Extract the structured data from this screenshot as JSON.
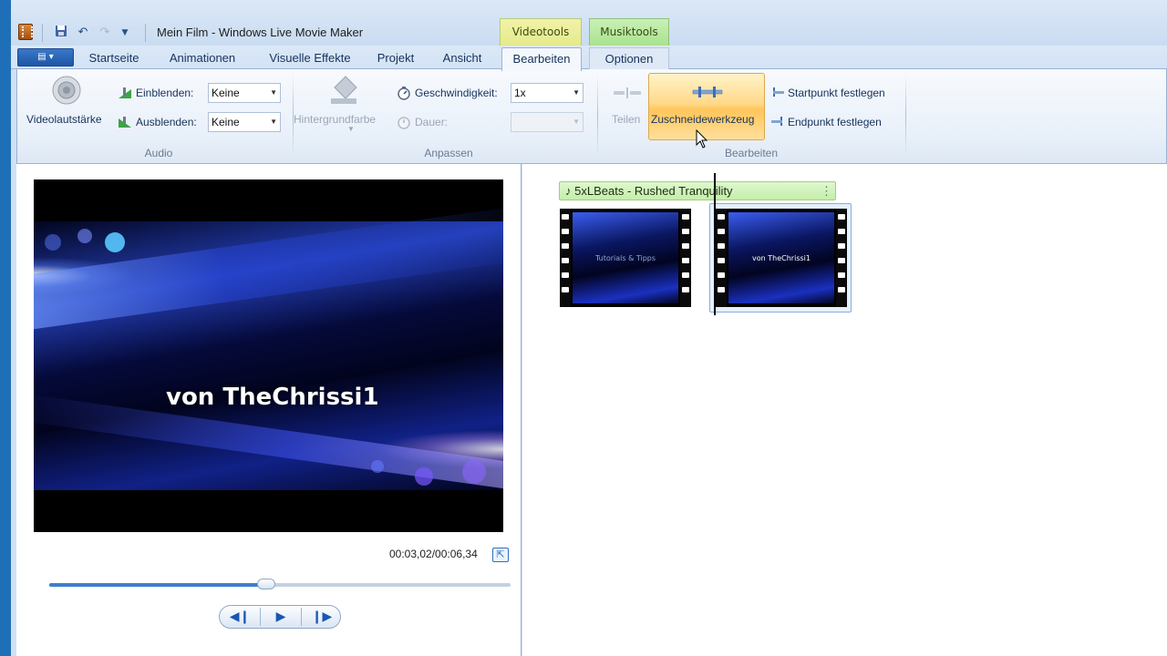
{
  "window": {
    "title": "Mein Film - Windows Live Movie Maker"
  },
  "context_tabs": {
    "video": "Videotools",
    "music": "Musiktools"
  },
  "tabs": [
    {
      "label": "Startseite"
    },
    {
      "label": "Animationen"
    },
    {
      "label": "Visuelle Effekte"
    },
    {
      "label": "Projekt"
    },
    {
      "label": "Ansicht"
    },
    {
      "label": "Bearbeiten"
    },
    {
      "label": "Optionen"
    }
  ],
  "active_tab": "Bearbeiten",
  "ribbon": {
    "audio": {
      "group_label": "Audio",
      "volume_label": "Videolautstärke",
      "fade_in_label": "Einblenden:",
      "fade_in_value": "Keine",
      "fade_out_label": "Ausblenden:",
      "fade_out_value": "Keine"
    },
    "adjust": {
      "group_label": "Anpassen",
      "bgcolor_label": "Hintergrundfarbe",
      "speed_label": "Geschwindigkeit:",
      "speed_value": "1x",
      "duration_label": "Dauer:",
      "duration_value": ""
    },
    "edit": {
      "group_label": "Bearbeiten",
      "split_label": "Teilen",
      "trim_label": "Zuschneidewerkzeug",
      "start_label": "Startpunkt festlegen",
      "end_label": "Endpunkt festlegen"
    }
  },
  "preview": {
    "overlay_text": "von TheChrissi1",
    "timecode": "00:03,02/00:06,34",
    "progress": 0.47
  },
  "storyboard": {
    "music_title": "5xLBeats - Rushed Tranquility",
    "clips": [
      {
        "caption": "Tutorials & Tipps"
      },
      {
        "caption": "von TheChrissi1"
      }
    ]
  },
  "colors": {
    "accent": "#3b7fd0",
    "context_video": "#e4ea8c",
    "context_music": "#a9e28e",
    "hover": "#ffc65a"
  }
}
